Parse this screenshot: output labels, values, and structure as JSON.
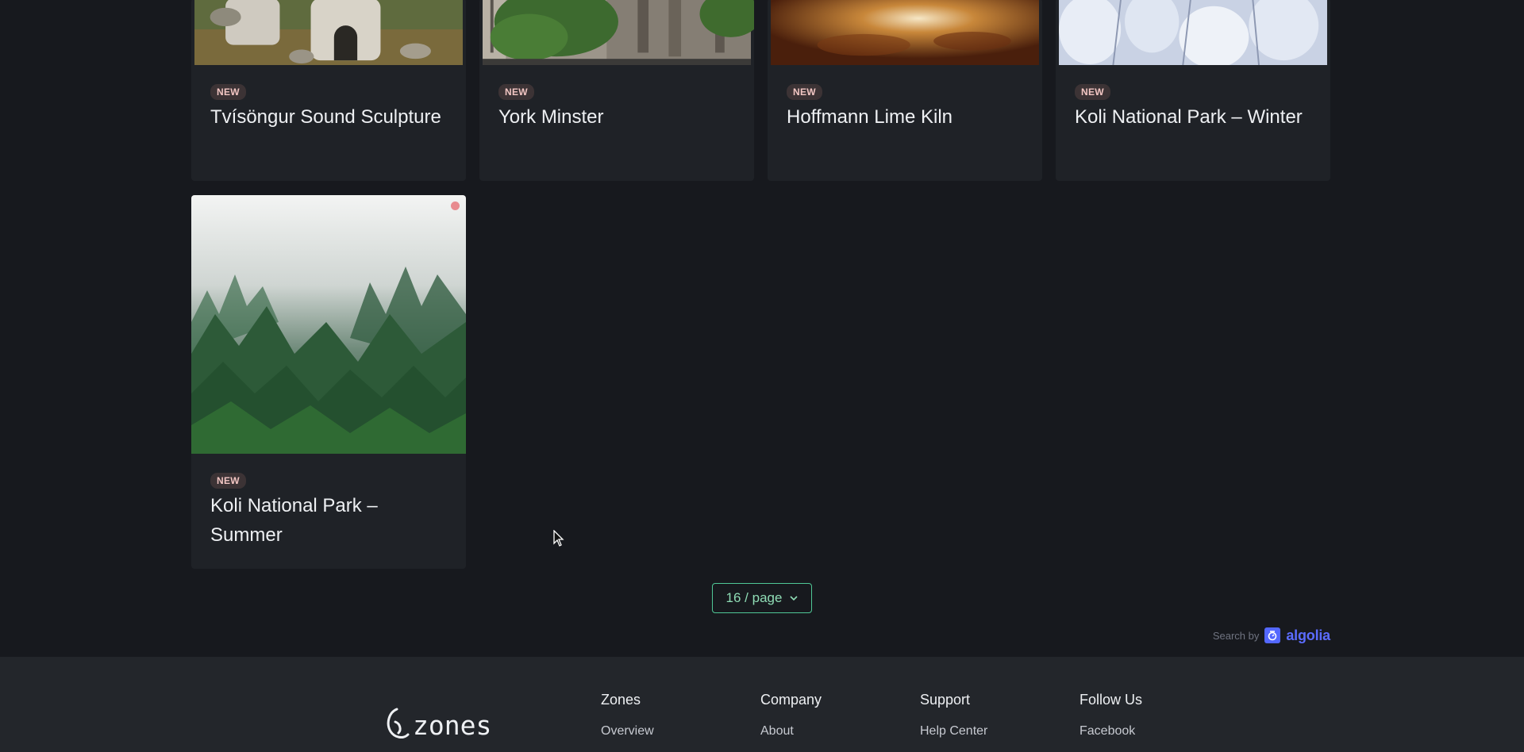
{
  "cards": [
    {
      "badge": "NEW",
      "title": "Tvísöngur Sound Sculpture"
    },
    {
      "badge": "NEW",
      "title": "York Minster"
    },
    {
      "badge": "NEW",
      "title": "Hoffmann Lime Kiln"
    },
    {
      "badge": "NEW",
      "title": "Koli National Park – Winter"
    },
    {
      "badge": "NEW",
      "title": "Koli National Park – Summer"
    }
  ],
  "pagination": {
    "page_size_label": "16 / page"
  },
  "search_by": {
    "label": "Search by",
    "brand": "algolia"
  },
  "footer": {
    "logo_text": "zones",
    "columns": [
      {
        "heading": "Zones",
        "first_link": "Overview"
      },
      {
        "heading": "Company",
        "first_link": "About"
      },
      {
        "heading": "Support",
        "first_link": "Help Center"
      },
      {
        "heading": "Follow Us",
        "first_link": "Facebook"
      }
    ]
  },
  "colors": {
    "accent": "#4fc796",
    "badge_bg": "#3c3335",
    "algolia": "#5468ff"
  }
}
